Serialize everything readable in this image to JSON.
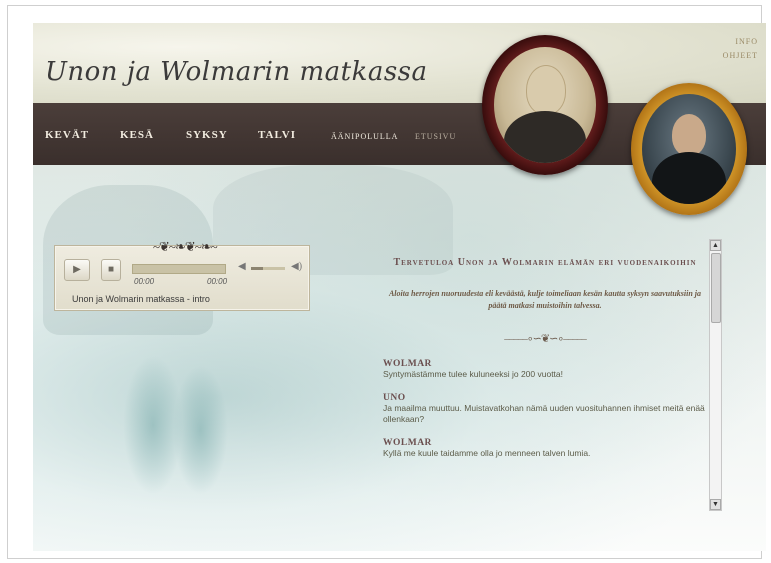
{
  "site": {
    "title": "Unon ja Wolmarin matkassa",
    "links": [
      "INFO",
      "OHJEET"
    ]
  },
  "nav": {
    "items": [
      "KEVÄT",
      "KESÄ",
      "SYKSY",
      "TALVI"
    ],
    "audio_trail": "ÄÄNIPOLULLA",
    "home": "ETUSIVU"
  },
  "player": {
    "time_elapsed": "00:00",
    "time_total": "00:00",
    "track_title": "Unon ja Wolmarin matkassa - intro",
    "progress": 0,
    "volume": 0.35
  },
  "content": {
    "welcome": "Tervetuloa Unon ja Wolmarin elämän eri vuodenaikoihin",
    "intro": "Aloita herrojen nuoruudesta eli keväästä, kulje toimeliaan kesän kautta syksyn saavutuksiin ja päätä matkasi muistoihin talvessa.",
    "dialogue": [
      {
        "speaker": "WOLMAR",
        "text": "Syntymästämme tulee kuluneeksi jo 200 vuotta!"
      },
      {
        "speaker": "UNO",
        "text": "Ja maailma muuttuu. Muistavatkohan nämä uuden vuosituhannen ihmiset meitä enää ollenkaan?"
      },
      {
        "speaker": "WOLMAR",
        "text": "Kyllä me kuule taidamme olla jo menneen talven lumia."
      }
    ]
  },
  "colors": {
    "nav_bg": "#3f3330",
    "accent_text": "#6b4f4f",
    "frame_red": "#6a1f1f",
    "frame_gold": "#d59a2a"
  }
}
